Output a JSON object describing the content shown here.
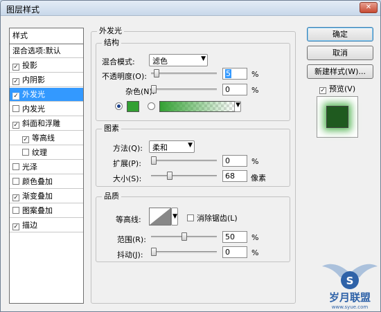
{
  "window": {
    "title": "图层样式",
    "close": "✕"
  },
  "styles_list": {
    "header": "样式",
    "items": [
      {
        "label": "混合选项:默认",
        "check": false,
        "checked": false,
        "selected": false
      },
      {
        "label": "投影",
        "check": true,
        "checked": true,
        "selected": false
      },
      {
        "label": "内阴影",
        "check": true,
        "checked": true,
        "selected": false
      },
      {
        "label": "外发光",
        "check": true,
        "checked": true,
        "selected": true
      },
      {
        "label": "内发光",
        "check": true,
        "checked": false,
        "selected": false
      },
      {
        "label": "斜面和浮雕",
        "check": true,
        "checked": true,
        "selected": false
      },
      {
        "label": "等高线",
        "check": true,
        "checked": true,
        "selected": false,
        "indent": true
      },
      {
        "label": "纹理",
        "check": true,
        "checked": false,
        "selected": false,
        "indent": true
      },
      {
        "label": "光泽",
        "check": true,
        "checked": false,
        "selected": false
      },
      {
        "label": "颜色叠加",
        "check": true,
        "checked": false,
        "selected": false
      },
      {
        "label": "渐变叠加",
        "check": true,
        "checked": true,
        "selected": false
      },
      {
        "label": "图案叠加",
        "check": true,
        "checked": false,
        "selected": false
      },
      {
        "label": "描边",
        "check": true,
        "checked": true,
        "selected": false
      }
    ]
  },
  "outer_glow": {
    "title": "外发光",
    "structure": {
      "title": "结构",
      "blend_mode_label": "混合模式:",
      "blend_mode_value": "滤色",
      "opacity_label": "不透明度(O):",
      "opacity_value": "5",
      "opacity_level": 0.05,
      "noise_label": "杂色(N):",
      "noise_value": "0",
      "noise_level": 0.0,
      "percent": "%",
      "glow_color": "#33a033",
      "color_mode": "solid"
    },
    "elements": {
      "title": "图素",
      "method_label": "方法(Q):",
      "method_value": "柔和",
      "spread_label": "扩展(P):",
      "spread_value": "0",
      "spread_level": 0.0,
      "size_label": "大小(S):",
      "size_value": "68",
      "size_level": 0.27,
      "size_unit": "像素",
      "percent": "%"
    },
    "quality": {
      "title": "品质",
      "contour_label": "等高线:",
      "anti_alias_label": "消除锯齿(L)",
      "anti_alias_checked": false,
      "range_label": "范围(R):",
      "range_value": "50",
      "range_level": 0.5,
      "jitter_label": "抖动(J):",
      "jitter_value": "0",
      "jitter_level": 0.0,
      "percent": "%"
    }
  },
  "buttons": {
    "ok": "确定",
    "cancel": "取消",
    "new_style": "新建样式(W)...",
    "preview_label": "预览(V)",
    "preview_checked": true
  },
  "watermark": {
    "text": "岁月联盟",
    "url": "www.syue.com"
  }
}
